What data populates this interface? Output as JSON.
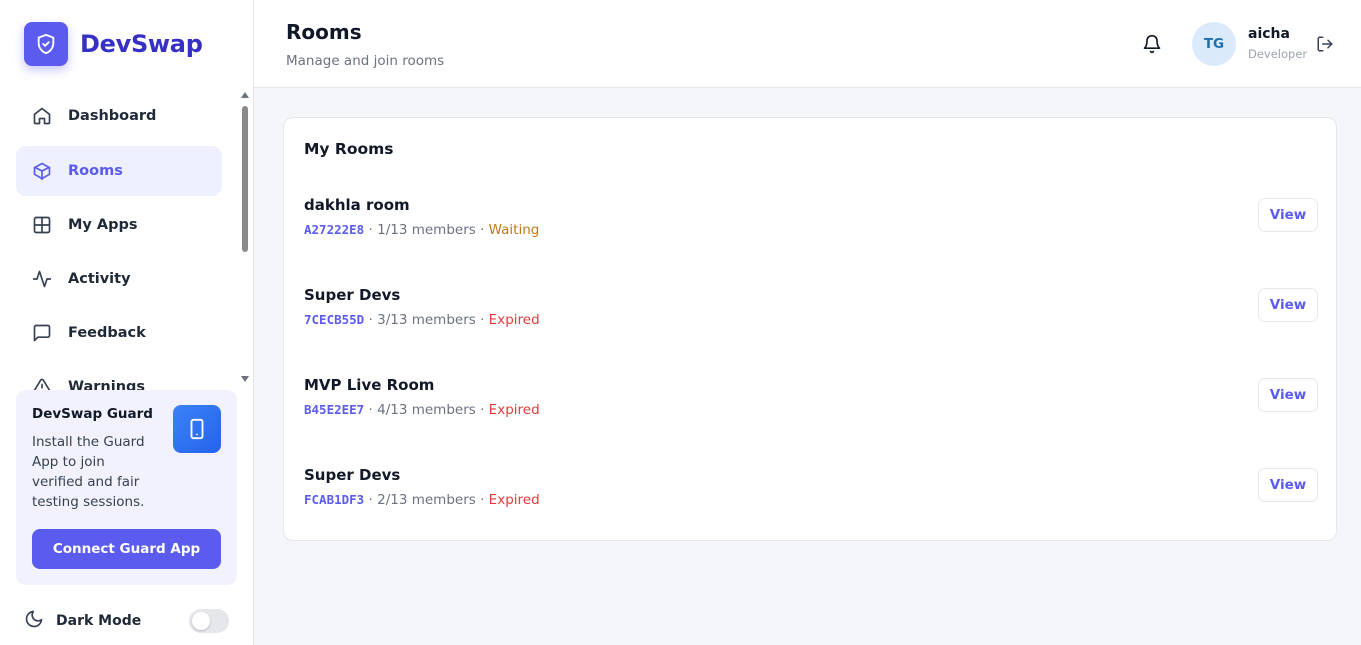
{
  "brand": {
    "name": "DevSwap",
    "logo_icon": "shield-check-icon",
    "color": "#5b5bf0"
  },
  "sidebar": {
    "items": [
      {
        "label": "Dashboard",
        "icon": "home-icon",
        "active": false
      },
      {
        "label": "Rooms",
        "icon": "cube-icon",
        "active": true
      },
      {
        "label": "My Apps",
        "icon": "grid-icon",
        "active": false
      },
      {
        "label": "Activity",
        "icon": "activity-icon",
        "active": false
      },
      {
        "label": "Feedback",
        "icon": "message-square-icon",
        "active": false
      },
      {
        "label": "Warnings",
        "icon": "alert-triangle-icon",
        "active": false
      }
    ]
  },
  "guard": {
    "title": "DevSwap Guard",
    "text": "Install the Guard App to join verified and fair testing sessions.",
    "button_label": "Connect Guard App",
    "icon": "smartphone-icon"
  },
  "dark_mode": {
    "label": "Dark Mode",
    "enabled": false,
    "icon": "moon-icon"
  },
  "header": {
    "title": "Rooms",
    "subtitle": "Manage and join rooms",
    "user": {
      "initials": "TG",
      "name": "aicha",
      "role": "Developer"
    }
  },
  "rooms_card": {
    "title": "My Rooms",
    "view_label": "View",
    "rooms": [
      {
        "name": "dakhla room",
        "code": "A27222E8",
        "members": "1/13 members",
        "status": "Waiting"
      },
      {
        "name": "Super Devs",
        "code": "7CECB55D",
        "members": "3/13 members",
        "status": "Expired"
      },
      {
        "name": "MVP Live Room",
        "code": "B45E2EE7",
        "members": "4/13 members",
        "status": "Expired"
      },
      {
        "name": "Super Devs",
        "code": "FCAB1DF3",
        "members": "2/13 members",
        "status": "Expired"
      }
    ]
  },
  "colors": {
    "accent": "#5b5bf0",
    "waiting": "#c2791c",
    "expired": "#e23b3b"
  }
}
